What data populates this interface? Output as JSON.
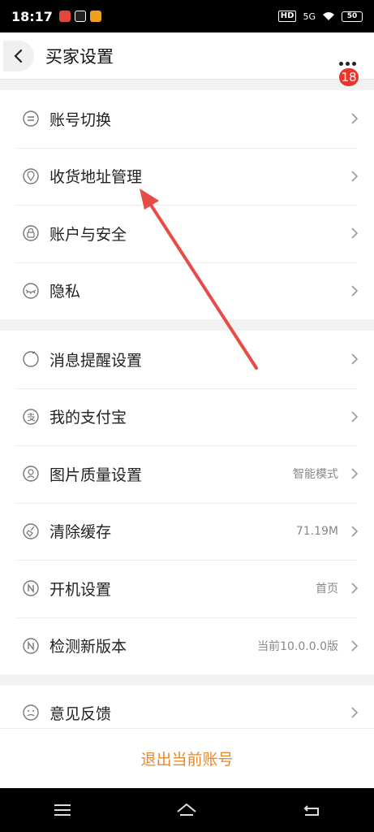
{
  "status_bar": {
    "time": "18:17",
    "hd": "HD",
    "network": "5G",
    "battery": "50"
  },
  "header": {
    "title": "买家设置",
    "badge_count": "18",
    "back_icon": "chevron-left-icon",
    "more_icon": "more-dots-icon"
  },
  "groups": [
    {
      "items": [
        {
          "label": "账号切换",
          "icon": "switch-account-icon",
          "value": ""
        },
        {
          "label": "收货地址管理",
          "icon": "location-pin-icon",
          "value": ""
        },
        {
          "label": "账户与安全",
          "icon": "lock-icon",
          "value": ""
        },
        {
          "label": "隐私",
          "icon": "eye-closed-icon",
          "value": ""
        }
      ]
    },
    {
      "items": [
        {
          "label": "消息提醒设置",
          "icon": "bell-icon",
          "value": ""
        },
        {
          "label": "我的支付宝",
          "icon": "alipay-icon",
          "value": ""
        },
        {
          "label": "图片质量设置",
          "icon": "image-quality-icon",
          "value": "智能模式"
        },
        {
          "label": "清除缓存",
          "icon": "broom-icon",
          "value": "71.19M"
        },
        {
          "label": "开机设置",
          "icon": "startup-n-icon",
          "value": "首页"
        },
        {
          "label": "检测新版本",
          "icon": "version-n-icon",
          "value": "当前10.0.0.0版"
        }
      ]
    },
    {
      "items": [
        {
          "label": "意见反馈",
          "icon": "feedback-face-icon",
          "value": ""
        }
      ]
    }
  ],
  "logout": {
    "label": "退出当前账号"
  },
  "colors": {
    "accent": "#e8892b",
    "badge": "#e8362d",
    "arrow": "#e84a45"
  }
}
